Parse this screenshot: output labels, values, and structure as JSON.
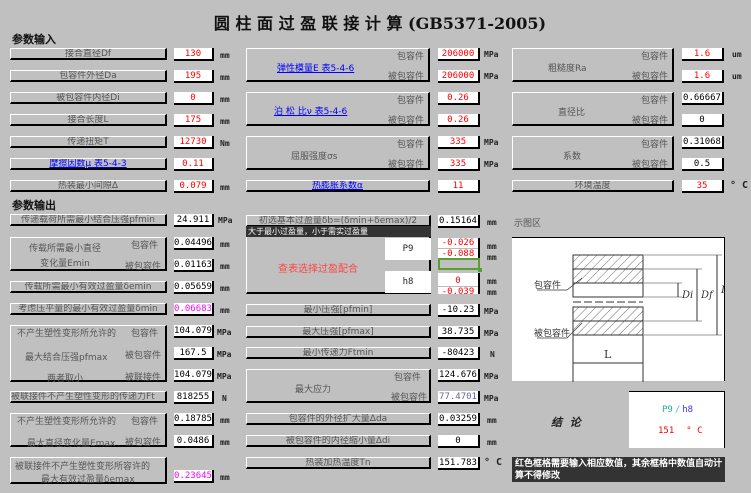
{
  "title": "圆 柱 面 过 盈 联 接 计 算 (GB5371-2005)",
  "input_section": "参数输入",
  "output_section": "参数输出",
  "sub": {
    "outer": "包容件",
    "inner": "被包容件",
    "joined": "被联接件"
  },
  "inputs": [
    {
      "label": "接合直径Df",
      "value": "130",
      "unit": "mm"
    },
    {
      "label": "包容件外径Da",
      "value": "195",
      "unit": "mm"
    },
    {
      "label": "被包容件内径Di",
      "value": "0",
      "unit": "mm"
    },
    {
      "label": "接合长度L",
      "value": "175",
      "unit": "mm"
    },
    {
      "label": "传递扭矩T",
      "value": "12730",
      "unit": "Nm"
    },
    {
      "label": "摩擦因数μ 表5-4-3",
      "value": "0.11",
      "unit": ""
    },
    {
      "label": "热装最小间隙Δ",
      "value": "0.079",
      "unit": "mm"
    }
  ],
  "material": {
    "elastic": {
      "label": "弹性模量E 表5-4-6",
      "outer": "206000",
      "inner": "206000",
      "unit": "MPa"
    },
    "poisson": {
      "label": "泊 松 比ν 表5-4-6",
      "outer": "0.26",
      "inner": "0.26"
    },
    "yield": {
      "label": "屈服强度σs",
      "outer": "335",
      "inner": "335",
      "unit": "MPa"
    },
    "expansion": {
      "label": "热膨胀系数α",
      "value": "11"
    }
  },
  "right_inputs": {
    "roughness": {
      "label": "粗糙度Ra",
      "outer": "1.6",
      "inner": "1.6",
      "unit": "um"
    },
    "ratio": {
      "label": "直径比",
      "outer": "0.66667",
      "inner": "0"
    },
    "coef": {
      "label": "系数",
      "outer": "0.31068",
      "inner": "0.5"
    },
    "ambient": {
      "label": "环境温度",
      "value": "35",
      "unit": "° C"
    }
  },
  "outputs": {
    "pfmin": {
      "label": "传递载荷所需最小结合压强pfmin",
      "value": "24.911",
      "unit": "MPa"
    },
    "emin": {
      "label": "传载所需最小直径变化量Emin",
      "outer": "0.04496",
      "inner": "0.01163",
      "unit": "mm"
    },
    "demin": {
      "label": "传载所需最小有效过盈量δemin",
      "value": "0.05659",
      "unit": "mm"
    },
    "dmin": {
      "label": "考虑压平量的最小有效过盈量δmin",
      "value": "0.06683",
      "unit": "mm"
    },
    "pfmax": {
      "label1": "不产生塑性变形所允许的",
      "label2": "最大结合压强pfmax",
      "label3": "两者取小",
      "outer": "104.079",
      "inner": "167.5",
      "joined": "104.079",
      "unit": "MPa"
    },
    "ft": {
      "label": "被联接件不产生塑性变形的传递力Ft",
      "value": "818255",
      "unit": "N"
    },
    "emax": {
      "label1": "不产生塑性变形所允许的",
      "label2": "最大直径变化量Emax",
      "outer": "0.18785",
      "inner": "0.0486",
      "unit": "mm"
    },
    "demax": {
      "label1": "被联接件不产生塑性变形所容许的",
      "label2": "最大有效过盈量δemax",
      "value": "0.23645",
      "unit": "mm"
    }
  },
  "fit": {
    "db": {
      "label": "初选基本过盈量δb=(δmin+δemax)/2",
      "value": "0.15164",
      "unit": "mm"
    },
    "hint": "大于最小过盈量，小于需实过盈量",
    "select": "查表选择过盈配合",
    "hole": "P9",
    "shaft": "h8",
    "hole_upper": "-0.026",
    "hole_lower": "-0.088",
    "shaft_upper": "0",
    "shaft_lower": "-0.039",
    "unit": "mm"
  },
  "results": {
    "pmin": {
      "label": "最小压强[pfmin]",
      "value": "-10.23",
      "unit": "MPa"
    },
    "pmax": {
      "label": "最大压强[pfmax]",
      "value": "38.735",
      "unit": "MPa"
    },
    "ftmin": {
      "label": "最小传递力Ftmin",
      "value": "-80423",
      "unit": "N"
    },
    "stress": {
      "label": "最大应力",
      "outer": "124.676",
      "inner": "77.4701",
      "unit": "MPa"
    },
    "dda": {
      "label": "包容件的外径扩大量Δda",
      "value": "0.03259",
      "unit": "mm"
    },
    "ddi": {
      "label": "被包容件的内径缩小量Δdi",
      "value": "0",
      "unit": "mm"
    },
    "tn": {
      "label": "热装加热温度Tn",
      "value": "151.783",
      "unit": "° C"
    }
  },
  "diagram": {
    "title": "示图区",
    "outer": "包容件",
    "inner": "被包容件",
    "di": "Di",
    "df": "Df",
    "da": "Da",
    "l": "L"
  },
  "conclusion": {
    "label": "结  论",
    "hole": "P9",
    "sep": "/",
    "shaft": "h8",
    "temp": "151",
    "temp_unit": "° C"
  },
  "note": "红色框格需要输入相应数值，其余框格中数值自动计算不得修改",
  "colors": {
    "background": "#c0c0c0",
    "input": "#ff0000",
    "highlight": "#ff00ff",
    "link": "#0000ff"
  }
}
